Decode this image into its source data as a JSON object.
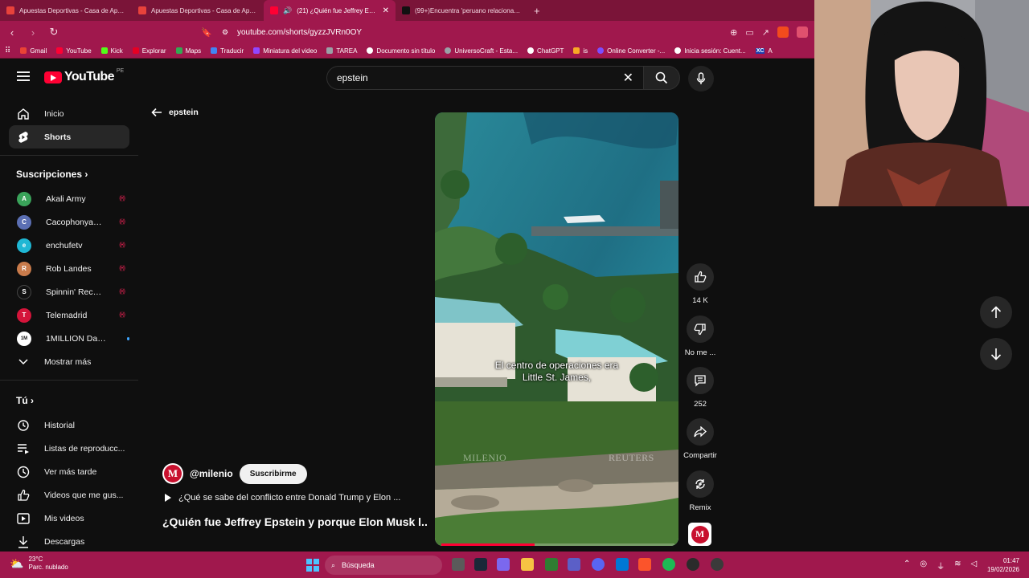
{
  "browser": {
    "tabs": [
      {
        "label": "Apuestas Deportivas - Casa de Apuestas",
        "favicon_color": "#e8423b",
        "active": false
      },
      {
        "label": "Apuestas Deportivas - Casa de Apuestas",
        "favicon_color": "#e8423b",
        "active": false
      },
      {
        "label": "(21) ¿Quién fue Jeffrey Epstein",
        "favicon_color": "#ff0033",
        "active": true
      },
      {
        "label": "(99+)Encuentra 'peruano relacionado",
        "favicon_color": "#111111",
        "active": false
      }
    ],
    "new_tab": "+",
    "url": "youtube.com/shorts/gyzzJVRn0OY",
    "bookmarks": [
      {
        "label": "Gmail",
        "color": "#ea4335"
      },
      {
        "label": "YouTube",
        "color": "#ff0033"
      },
      {
        "label": "Kick",
        "color": "#53fc18"
      },
      {
        "label": "Explorar",
        "color": "#e60023"
      },
      {
        "label": "Maps",
        "color": "#34a853"
      },
      {
        "label": "Traducir",
        "color": "#4285f4"
      },
      {
        "label": "Miniatura del video",
        "color": "#9146ff"
      },
      {
        "label": "TAREA",
        "color": "#9aa0a6"
      },
      {
        "label": "Documento sin título",
        "color": "#ffffff"
      },
      {
        "label": "UniversoCraft - Esta...",
        "color": "#9aa0a6"
      },
      {
        "label": "ChatGPT",
        "color": "#ffffff"
      },
      {
        "label": "is",
        "color": "#f9a825"
      },
      {
        "label": "Online Converter -...",
        "color": "#7c4dff"
      },
      {
        "label": "Inicia sesión: Cuent...",
        "color": "#ffffff"
      },
      {
        "label": "A",
        "color": "#1e40af"
      }
    ],
    "bookmark_xc": "XC"
  },
  "youtube": {
    "logo_text": "YouTube",
    "country_code": "PE",
    "search_value": "epstein",
    "sidebar": {
      "main": [
        {
          "label": "Inicio",
          "icon": "home-icon",
          "selected": false
        },
        {
          "label": "Shorts",
          "icon": "shorts-icon",
          "selected": true
        }
      ],
      "subscriptions_header": "Suscripciones",
      "subscriptions": [
        {
          "label": "Akali Army",
          "color": "#3aa35a",
          "initial": "A",
          "live": true
        },
        {
          "label": "CacophonyandDi...",
          "color": "#5b6fb3",
          "initial": "C",
          "live": true
        },
        {
          "label": "enchufetv",
          "color": "#1fb7d4",
          "initial": "e",
          "live": true
        },
        {
          "label": "Rob Landes",
          "color": "#c97b4b",
          "initial": "R",
          "live": true
        },
        {
          "label": "Spinnin' Records",
          "color": "#111111",
          "initial": "S",
          "live": true
        },
        {
          "label": "Telemadrid",
          "color": "#d4143a",
          "initial": "T",
          "live": true
        },
        {
          "label": "1MILLION Dance...",
          "color": "#ffffff",
          "initial": "1M",
          "live": false
        }
      ],
      "show_more": "Mostrar más",
      "you_header": "Tú",
      "you_items": [
        {
          "label": "Historial",
          "icon": "history-icon"
        },
        {
          "label": "Listas de reproducc...",
          "icon": "playlists-icon"
        },
        {
          "label": "Ver más tarde",
          "icon": "watch-later-icon"
        },
        {
          "label": "Videos que me gus...",
          "icon": "liked-icon"
        },
        {
          "label": "Mis videos",
          "icon": "my-videos-icon"
        },
        {
          "label": "Descargas",
          "icon": "downloads-icon"
        }
      ]
    },
    "back_label": "epstein",
    "short": {
      "subtitle_line1": "El centro de operaciones era",
      "subtitle_line2": "Little St. James,",
      "watermark_left": "MILENIO",
      "watermark_right": "REUTERS",
      "progress": 0.4,
      "channel_handle": "@milenio",
      "channel_initial": "M",
      "subscribe_label": "Suscribirme",
      "related_text": "¿Qué se sabe del conflicto entre Donald Trump y Elon ...",
      "title": "¿Quién fue Jeffrey Epstein y porque Elon Musk l..."
    },
    "actions": {
      "like_count": "14 K",
      "dislike_label": "No me ...",
      "comment_count": "252",
      "share_label": "Compartir",
      "remix_label": "Remix"
    }
  },
  "taskbar": {
    "temperature": "23°C",
    "weather": "Parc. nublado",
    "search_label": "Búsqueda",
    "time": "01:47",
    "date": "19/02/2026"
  }
}
